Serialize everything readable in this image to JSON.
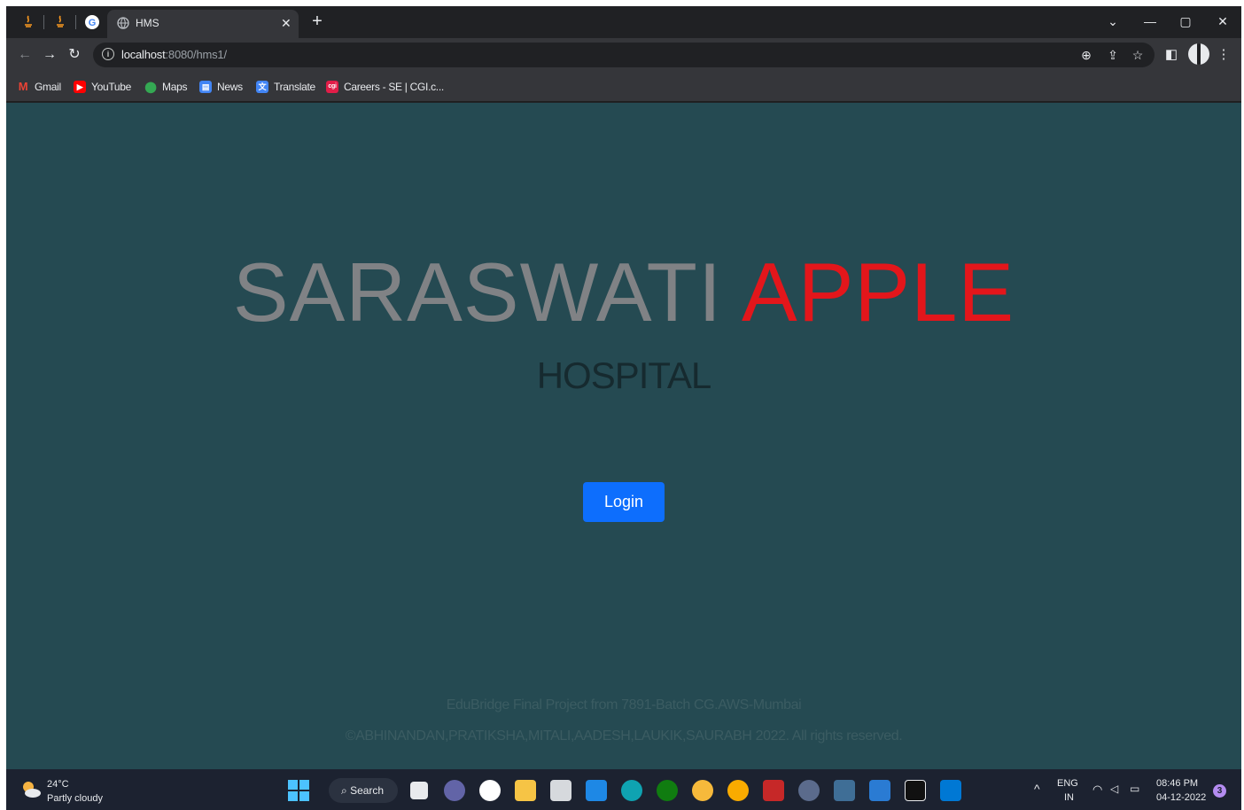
{
  "browser": {
    "tab_title": "HMS",
    "url_host": "localhost",
    "url_rest": ":8080/hms1/",
    "bookmarks": [
      {
        "label": "Gmail",
        "icon": "gmail-icon",
        "color": "#ea4335"
      },
      {
        "label": "YouTube",
        "icon": "youtube-icon",
        "color": "#ff0000"
      },
      {
        "label": "Maps",
        "icon": "maps-icon",
        "color": "#34a853"
      },
      {
        "label": "News",
        "icon": "news-icon",
        "color": "#4285f4"
      },
      {
        "label": "Translate",
        "icon": "translate-icon",
        "color": "#4285f4"
      },
      {
        "label": "Careers - SE | CGI.c...",
        "icon": "cgi-icon",
        "color": "#e11d48"
      }
    ]
  },
  "page": {
    "brand_word1": "SARASWATI",
    "brand_word2": "APPLE",
    "subtitle": "HOSPITAL",
    "login_label": "Login",
    "footer_line1": "EduBridge Final Project from 7891-Batch CG.AWS-Mumbai",
    "footer_line2": "©ABHINANDAN,PRATIKSHA,MITALI,AADESH,LAUKIK,SAURABH 2022. All rights reserved.",
    "colors": {
      "background": "#254a52",
      "brand_gray": "#808285",
      "brand_red": "#e3161b",
      "button": "#0d6efd"
    }
  },
  "taskbar": {
    "weather_temp": "24°C",
    "weather_desc": "Partly cloudy",
    "search_label": "Search",
    "lang_top": "ENG",
    "lang_bottom": "IN",
    "time": "08:46 PM",
    "date": "04-12-2022",
    "notification_count": "3"
  }
}
